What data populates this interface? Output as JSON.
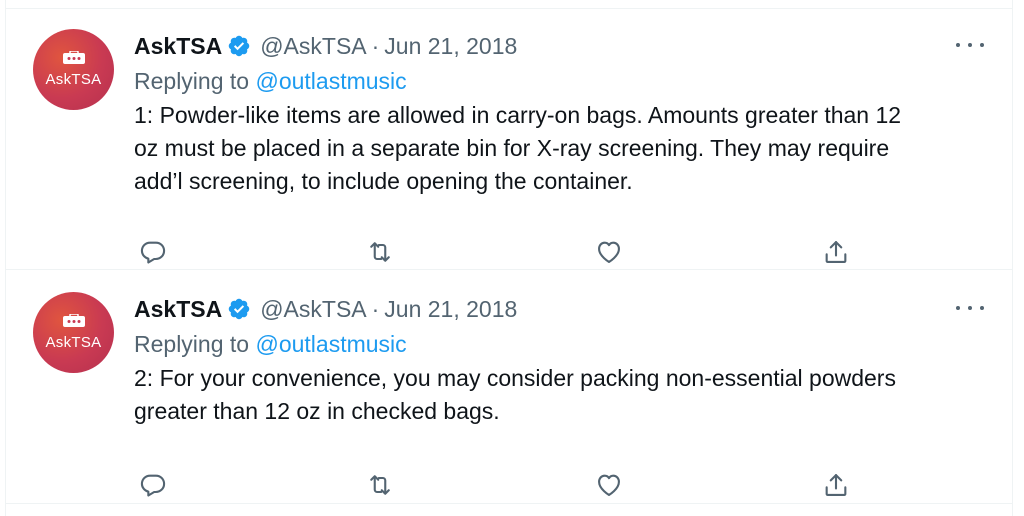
{
  "tweets": [
    {
      "name": "AskTSA",
      "handle": "@AskTSA",
      "separator": "·",
      "date": "Jun 21, 2018",
      "avatar_text": "AskTSA",
      "replying_prefix": "Replying to",
      "replying_to": "@outlastmusic",
      "lines": [
        "1: Powder-like items are allowed in carry-on bags. Amounts greater than 12",
        "oz must be placed in a separate bin for X-ray screening. They may require",
        "add’l screening, to include opening the container."
      ],
      "icons": {
        "reply": "reply-icon",
        "retweet": "retweet-icon",
        "like": "like-icon",
        "share": "share-icon",
        "more": "more-icon",
        "verified": "verified-badge-icon"
      }
    },
    {
      "name": "AskTSA",
      "handle": "@AskTSA",
      "separator": "·",
      "date": "Jun 21, 2018",
      "avatar_text": "AskTSA",
      "replying_prefix": "Replying to",
      "replying_to": "@outlastmusic",
      "lines": [
        "2: For your convenience, you may consider packing non-essential powders",
        "greater than 12 oz in checked bags."
      ],
      "icons": {
        "reply": "reply-icon",
        "retweet": "retweet-icon",
        "like": "like-icon",
        "share": "share-icon",
        "more": "more-icon",
        "verified": "verified-badge-icon"
      }
    }
  ],
  "colors": {
    "accent": "#1d9bf0",
    "text": "#0f1419",
    "muted": "#536471",
    "divider": "#eff3f4",
    "avatar": "#c93a52"
  }
}
